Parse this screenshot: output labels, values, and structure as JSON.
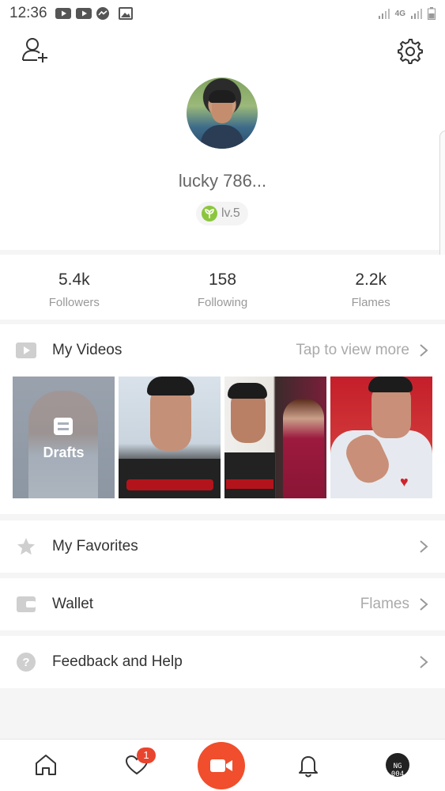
{
  "status_bar": {
    "time": "12:36",
    "network": "4G"
  },
  "profile": {
    "username": "lucky 786...",
    "level": "lv.5"
  },
  "stats": [
    {
      "value": "5.4k",
      "label": "Followers"
    },
    {
      "value": "158",
      "label": "Following"
    },
    {
      "value": "2.2k",
      "label": "Flames"
    }
  ],
  "videos": {
    "title": "My Videos",
    "more": "Tap to view more",
    "drafts_label": "Drafts"
  },
  "menu": {
    "favorites": "My Favorites",
    "wallet": "Wallet",
    "wallet_right": "Flames",
    "help": "Feedback and Help"
  },
  "tabbar": {
    "likes_badge": "1",
    "me_text": "NG 004"
  },
  "colors": {
    "accent": "#f04e2c",
    "badge": "#e8452f",
    "level_green": "#8cc63f"
  }
}
